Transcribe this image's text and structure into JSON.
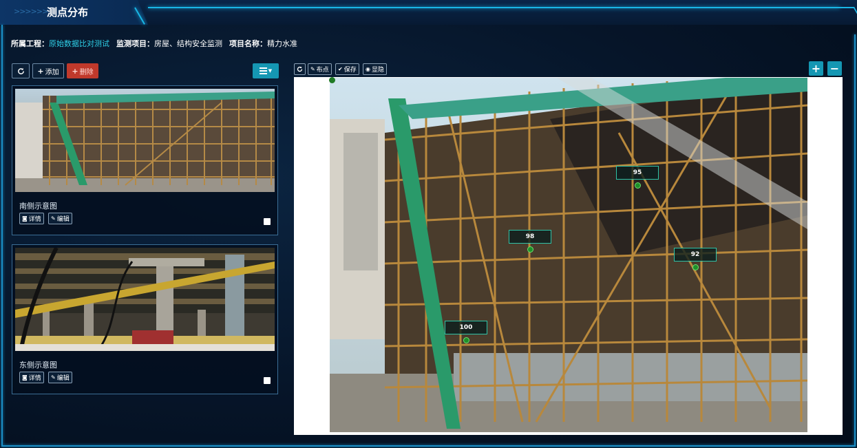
{
  "page": {
    "title": "测点分布",
    "title_arrows": ">>>>>>"
  },
  "info": {
    "project_label": "所属工程：",
    "project_value": "原始数据比对测试",
    "monitor_label": "监测项目：",
    "monitor_value": "房屋、结构安全监测",
    "item_label": "项目名称：",
    "item_value": "精力水准"
  },
  "left_toolbar": {
    "add_label": "添加",
    "delete_label": "删除"
  },
  "cards": [
    {
      "caption": "南侧示意图",
      "detail_label": "详情",
      "edit_label": "编辑",
      "checked": false
    },
    {
      "caption": "东侧示意图",
      "detail_label": "详情",
      "edit_label": "编辑",
      "checked": false
    }
  ],
  "view_toolbar": {
    "point_label": "布点",
    "save_label": "保存",
    "hide_label": "显隐"
  },
  "zoom": {
    "in_label": "+",
    "out_label": "−"
  },
  "markers": [
    {
      "label": "95"
    },
    {
      "label": "98"
    },
    {
      "label": "92"
    },
    {
      "label": "100"
    }
  ],
  "colors": {
    "accent": "#1597b3",
    "highlight_text": "#2fd0e8",
    "delete_red": "#c0392b",
    "marker_dot": "#1f8f2a",
    "border_glow": "#19b6e6"
  },
  "icons": {
    "refresh": "refresh-icon",
    "add": "plus-icon",
    "delete": "plus-icon",
    "grid": "grid-icon",
    "detail": "camera-icon",
    "edit": "pencil-icon",
    "point": "pencil-icon",
    "save": "check-icon",
    "hide": "eye-icon"
  }
}
